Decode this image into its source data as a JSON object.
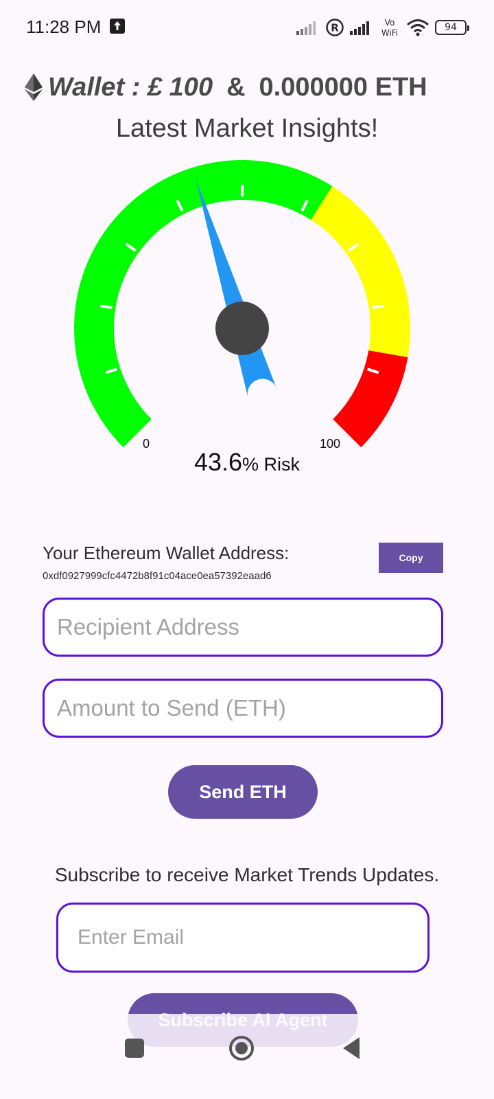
{
  "status_bar": {
    "time": "11:28 PM",
    "battery": "94",
    "network_label": "Vo WiFi"
  },
  "wallet": {
    "label": "Wallet : £ 100",
    "separator": "&",
    "eth_balance": "0.000000 ETH"
  },
  "insights": {
    "title": "Latest Market Insights!"
  },
  "gauge": {
    "min_label": "0",
    "max_label": "100",
    "value": 43.6,
    "value_text": "43.6",
    "unit_text": "% Risk",
    "bands": [
      {
        "from": 0,
        "to": 62,
        "color": "#00FF00"
      },
      {
        "from": 62,
        "to": 87,
        "color": "#FFFF00"
      },
      {
        "from": 87,
        "to": 100,
        "color": "#FF0000"
      }
    ],
    "needle_color": "#2196F3",
    "hub_color": "#444444"
  },
  "address": {
    "label": "Your Ethereum Wallet Address:",
    "value": "0xdf0927999cfc4472b8f91c04ace0ea57392eaad6",
    "copy_label": "Copy"
  },
  "send_form": {
    "recipient_placeholder": "Recipient Address",
    "amount_placeholder": "Amount to Send (ETH)",
    "send_label": "Send ETH"
  },
  "subscribe": {
    "text": "Subscribe to receive Market Trends Updates.",
    "email_placeholder": "Enter Email",
    "button_label": "Subscribe AI Agent"
  },
  "colors": {
    "primary": "#6750A4",
    "field_border": "#5B12D9",
    "background": "#FDF7FE"
  }
}
